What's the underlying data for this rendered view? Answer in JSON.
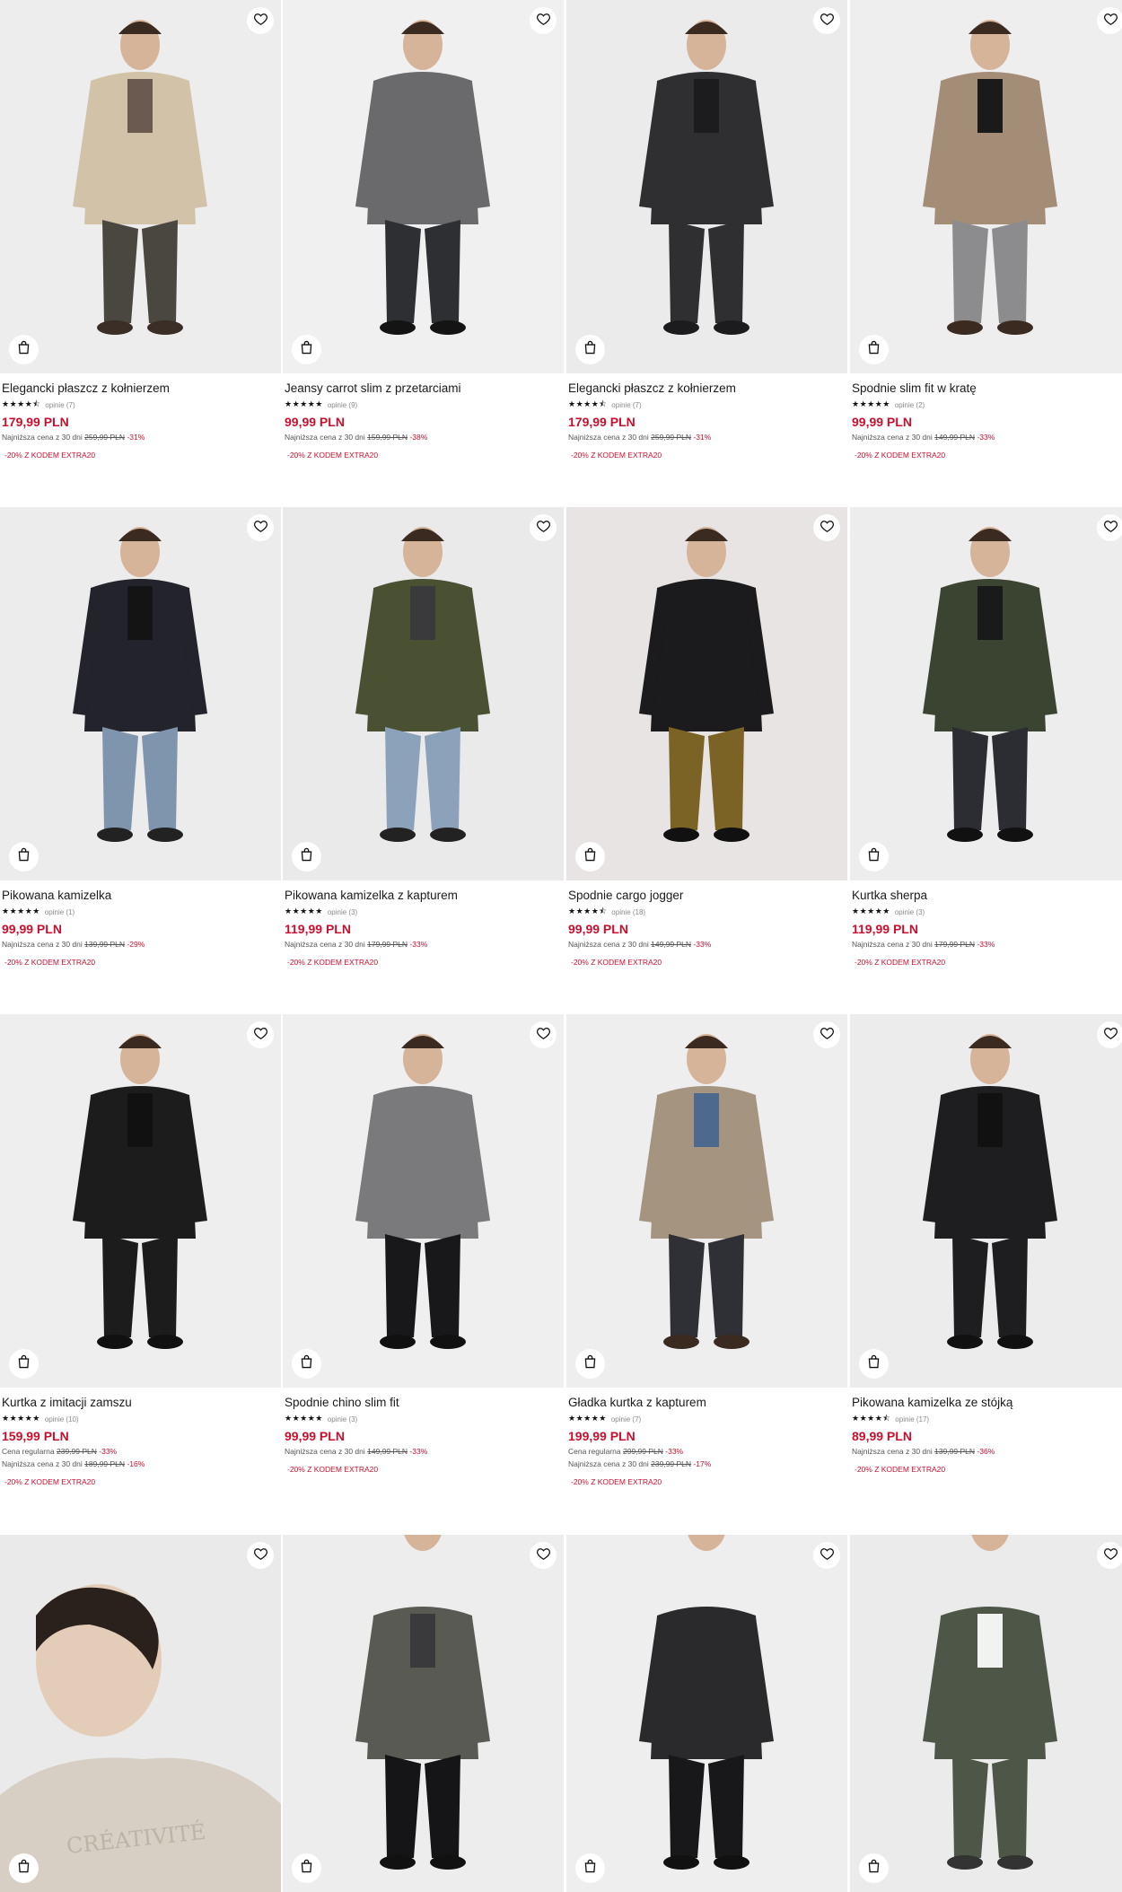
{
  "colors": {
    "price": "#c8102e",
    "promo": "#c8102e",
    "background": "#ffffff"
  },
  "icons": {
    "favorite": "heart-icon",
    "add_to_cart": "shopping-bag-icon",
    "rating": "star-icon"
  },
  "products": [
    {
      "title": "Elegancki płaszcz z kołnierzem",
      "stars": "★★★★⯪",
      "reviews": "opinie (7)",
      "price": "179,99 PLN",
      "lines": [
        {
          "label": "Najniższa cena z 30 dni",
          "old": "259,99 PLN",
          "disc": "-31%"
        }
      ],
      "promo": "-20% Z KODEM EXTRA20",
      "bg": "#ededee",
      "coat": "#d2c2a8",
      "pants": "#4a4640",
      "top": "#6b5a50",
      "shoe": "#3a2e26"
    },
    {
      "title": "Jeansy carrot slim z przetarciami",
      "stars": "★★★★★",
      "reviews": "opinie (9)",
      "price": "99,99 PLN",
      "lines": [
        {
          "label": "Najniższa cena z 30 dni",
          "old": "159,99 PLN",
          "disc": "-38%"
        }
      ],
      "promo": "-20% Z KODEM EXTRA20",
      "bg": "#f0f0f1",
      "coat": "#6a6a6c",
      "pants": "#2e2f33",
      "top": "#6a6a6c",
      "shoe": "#141414"
    },
    {
      "title": "Elegancki płaszcz z kołnierzem",
      "stars": "★★★★⯪",
      "reviews": "opinie (7)",
      "price": "179,99 PLN",
      "lines": [
        {
          "label": "Najniższa cena z 30 dni",
          "old": "259,99 PLN",
          "disc": "-31%"
        }
      ],
      "promo": "-20% Z KODEM EXTRA20",
      "bg": "#ebebec",
      "coat": "#2f2f31",
      "pants": "#2f2f31",
      "top": "#1c1c1e",
      "shoe": "#1c1c1e"
    },
    {
      "title": "Spodnie slim fit w kratę",
      "stars": "★★★★★",
      "reviews": "opinie (2)",
      "price": "99,99 PLN",
      "lines": [
        {
          "label": "Najniższa cena z 30 dni",
          "old": "149,99 PLN",
          "disc": "-33%"
        }
      ],
      "promo": "-20% Z KODEM EXTRA20",
      "bg": "#eeeeef",
      "coat": "#a48d76",
      "pants": "#8c8c8e",
      "top": "#1a1a1a",
      "shoe": "#3a2a20"
    },
    {
      "title": "Pikowana kamizelka",
      "stars": "★★★★★",
      "reviews": "opinie (1)",
      "price": "99,99 PLN",
      "lines": [
        {
          "label": "Najniższa cena z 30 dni",
          "old": "139,99 PLN",
          "disc": "-29%"
        }
      ],
      "promo": "-20% Z KODEM EXTRA20",
      "bg": "#ececed",
      "coat": "#22232b",
      "pants": "#7f95ad",
      "top": "#141414",
      "shoe": "#222"
    },
    {
      "title": "Pikowana kamizelka z kapturem",
      "stars": "★★★★★",
      "reviews": "opinie (3)",
      "price": "119,99 PLN",
      "lines": [
        {
          "label": "Najniższa cena z 30 dni",
          "old": "179,99 PLN",
          "disc": "-33%"
        }
      ],
      "promo": "-20% Z KODEM EXTRA20",
      "bg": "#eaeaeb",
      "coat": "#4a5133",
      "pants": "#8ca2bb",
      "top": "#3a3a3c",
      "shoe": "#222"
    },
    {
      "title": "Spodnie cargo jogger",
      "stars": "★★★★⯪",
      "reviews": "opinie (18)",
      "price": "99,99 PLN",
      "lines": [
        {
          "label": "Najniższa cena z 30 dni",
          "old": "149,99 PLN",
          "disc": "-33%"
        }
      ],
      "promo": "-20% Z KODEM EXTRA20",
      "bg": "#e7e4e3",
      "coat": "#1b1b1d",
      "pants": "#7a6324",
      "top": "#1b1b1d",
      "shoe": "#111"
    },
    {
      "title": "Kurtka sherpa",
      "stars": "★★★★★",
      "reviews": "opinie (3)",
      "price": "119,99 PLN",
      "lines": [
        {
          "label": "Najniższa cena z 30 dni",
          "old": "179,99 PLN",
          "disc": "-33%"
        }
      ],
      "promo": "-20% Z KODEM EXTRA20",
      "bg": "#ededee",
      "coat": "#3b4430",
      "pants": "#2c2d33",
      "top": "#1a1a1a",
      "shoe": "#111"
    },
    {
      "title": "Kurtka z imitacji zamszu",
      "stars": "★★★★★",
      "reviews": "opinie (10)",
      "price": "159,99 PLN",
      "lines": [
        {
          "label": "Cena regularna",
          "old": "239,99 PLN",
          "disc": "-33%"
        },
        {
          "label": "Najniższa cena z 30 dni",
          "old": "189,99 PLN",
          "disc": "-16%"
        }
      ],
      "promo": "-20% Z KODEM EXTRA20",
      "bg": "#eeeeef",
      "coat": "#1c1c1d",
      "pants": "#1c1c1d",
      "top": "#111",
      "shoe": "#111"
    },
    {
      "title": "Spodnie chino slim fit",
      "stars": "★★★★★",
      "reviews": "opinie (3)",
      "price": "99,99 PLN",
      "lines": [
        {
          "label": "Najniższa cena z 30 dni",
          "old": "149,99 PLN",
          "disc": "-33%"
        }
      ],
      "promo": "-20% Z KODEM EXTRA20",
      "bg": "#efeff0",
      "coat": "#7a7a7c",
      "pants": "#18181b",
      "top": "#7a7a7c",
      "shoe": "#111"
    },
    {
      "title": "Gładka kurtka z kapturem",
      "stars": "★★★★★",
      "reviews": "opinie (7)",
      "price": "199,99 PLN",
      "lines": [
        {
          "label": "Cena regularna",
          "old": "299,99 PLN",
          "disc": "-33%"
        },
        {
          "label": "Najniższa cena z 30 dni",
          "old": "239,99 PLN",
          "disc": "-17%"
        }
      ],
      "promo": "-20% Z KODEM EXTRA20",
      "bg": "#eeeeef",
      "coat": "#a59580",
      "pants": "#2e3036",
      "top": "#4d6a8e",
      "shoe": "#3a2a20"
    },
    {
      "title": "Pikowana kamizelka ze stójką",
      "stars": "★★★★⯪",
      "reviews": "opinie (17)",
      "price": "89,99 PLN",
      "lines": [
        {
          "label": "Najniższa cena z 30 dni",
          "old": "139,99 PLN",
          "disc": "-36%"
        }
      ],
      "promo": "-20% Z KODEM EXTRA20",
      "bg": "#ececed",
      "coat": "#1e1e20",
      "pants": "#1e1e20",
      "top": "#111",
      "shoe": "#111"
    },
    {
      "title": "",
      "stars": "",
      "reviews": "",
      "price": "",
      "lines": [],
      "promo": "",
      "bg": "#eaeaeb",
      "coat": "#d7cfc3",
      "pants": "#d7cfc3",
      "top": "#d7cfc3",
      "shoe": "#d7cfc3",
      "print": "CRÉATIVITÉ"
    },
    {
      "title": "",
      "stars": "",
      "reviews": "",
      "price": "",
      "lines": [],
      "promo": "",
      "bg": "#ededee",
      "coat": "#5a5a54",
      "pants": "#151517",
      "top": "#3a3a3c",
      "shoe": "#111"
    },
    {
      "title": "",
      "stars": "",
      "reviews": "",
      "price": "",
      "lines": [],
      "promo": "",
      "bg": "#eeeeef",
      "coat": "#2a2a2c",
      "pants": "#18181b",
      "top": "#2a2a2c",
      "shoe": "#111"
    },
    {
      "title": "",
      "stars": "",
      "reviews": "",
      "price": "",
      "lines": [],
      "promo": "",
      "bg": "#ebebec",
      "coat": "#4e5648",
      "pants": "#4e5648",
      "top": "#f2f2f2",
      "shoe": "#333"
    }
  ]
}
